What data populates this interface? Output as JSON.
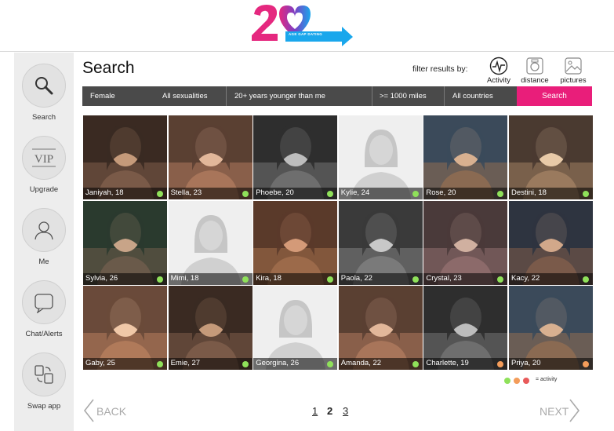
{
  "brand": {
    "tagline": "AGE GAP DATING"
  },
  "sidebar": {
    "items": [
      {
        "label": "Search",
        "icon": "search-icon"
      },
      {
        "label": "Upgrade",
        "icon": "vip-icon",
        "icon_text": "VIP"
      },
      {
        "label": "Me",
        "icon": "user-icon"
      },
      {
        "label": "Chat/Alerts",
        "icon": "chat-icon"
      },
      {
        "label": "Swap app",
        "icon": "swap-app-icon"
      }
    ]
  },
  "page": {
    "title": "Search",
    "filter_results_by": "filter results by:"
  },
  "filter_buttons": [
    {
      "label": "Activity",
      "icon": "activity-icon"
    },
    {
      "label": "distance",
      "icon": "distance-icon"
    },
    {
      "label": "pictures",
      "icon": "pictures-icon"
    }
  ],
  "filters": {
    "gender": "Female",
    "sexuality": "All sexualities",
    "age": "20+ years younger than me",
    "distance": ">= 1000 miles",
    "country": "All countries",
    "search_label": "Search"
  },
  "profiles": [
    {
      "caption": "Janiyah, 18",
      "activity": "online",
      "photo": true
    },
    {
      "caption": "Stella, 23",
      "activity": "online",
      "photo": true
    },
    {
      "caption": "Phoebe, 20",
      "activity": "online",
      "photo": true
    },
    {
      "caption": "Kylie, 24",
      "activity": "online",
      "photo": false
    },
    {
      "caption": "Rose, 20",
      "activity": "online",
      "photo": true
    },
    {
      "caption": "Destini, 18",
      "activity": "online",
      "photo": true
    },
    {
      "caption": "Sylvia, 26",
      "activity": "online",
      "photo": true
    },
    {
      "caption": "Mimi, 18",
      "activity": "online",
      "photo": false
    },
    {
      "caption": "Kira, 18",
      "activity": "online",
      "photo": true
    },
    {
      "caption": "Paola, 22",
      "activity": "online",
      "photo": true
    },
    {
      "caption": "Crystal, 23",
      "activity": "online",
      "photo": true
    },
    {
      "caption": "Kacy, 22",
      "activity": "online",
      "photo": true
    },
    {
      "caption": "Gaby, 25",
      "activity": "online",
      "photo": true
    },
    {
      "caption": "Emie, 27",
      "activity": "online",
      "photo": true
    },
    {
      "caption": "Georgina, 26",
      "activity": "online",
      "photo": false
    },
    {
      "caption": "Amanda, 22",
      "activity": "online",
      "photo": true
    },
    {
      "caption": "Charlette, 19",
      "activity": "recent",
      "photo": true
    },
    {
      "caption": "Priya, 20",
      "activity": "recent",
      "photo": true
    }
  ],
  "activity_legend": {
    "label": "= activity",
    "colors": {
      "online": "#8fe15a",
      "recent": "#f39c5a",
      "away": "#e85a5a"
    }
  },
  "pagination": {
    "back_label": "BACK",
    "next_label": "NEXT",
    "pages": [
      "1",
      "2",
      "3"
    ],
    "current": "2"
  },
  "colors": {
    "accent": "#e91e7a",
    "logo_pink": "#e5287f",
    "logo_purple": "#7b3fc4",
    "logo_blue": "#1aa7ec",
    "filterbar": "#4a4a4a",
    "sidebar": "#ededed"
  }
}
